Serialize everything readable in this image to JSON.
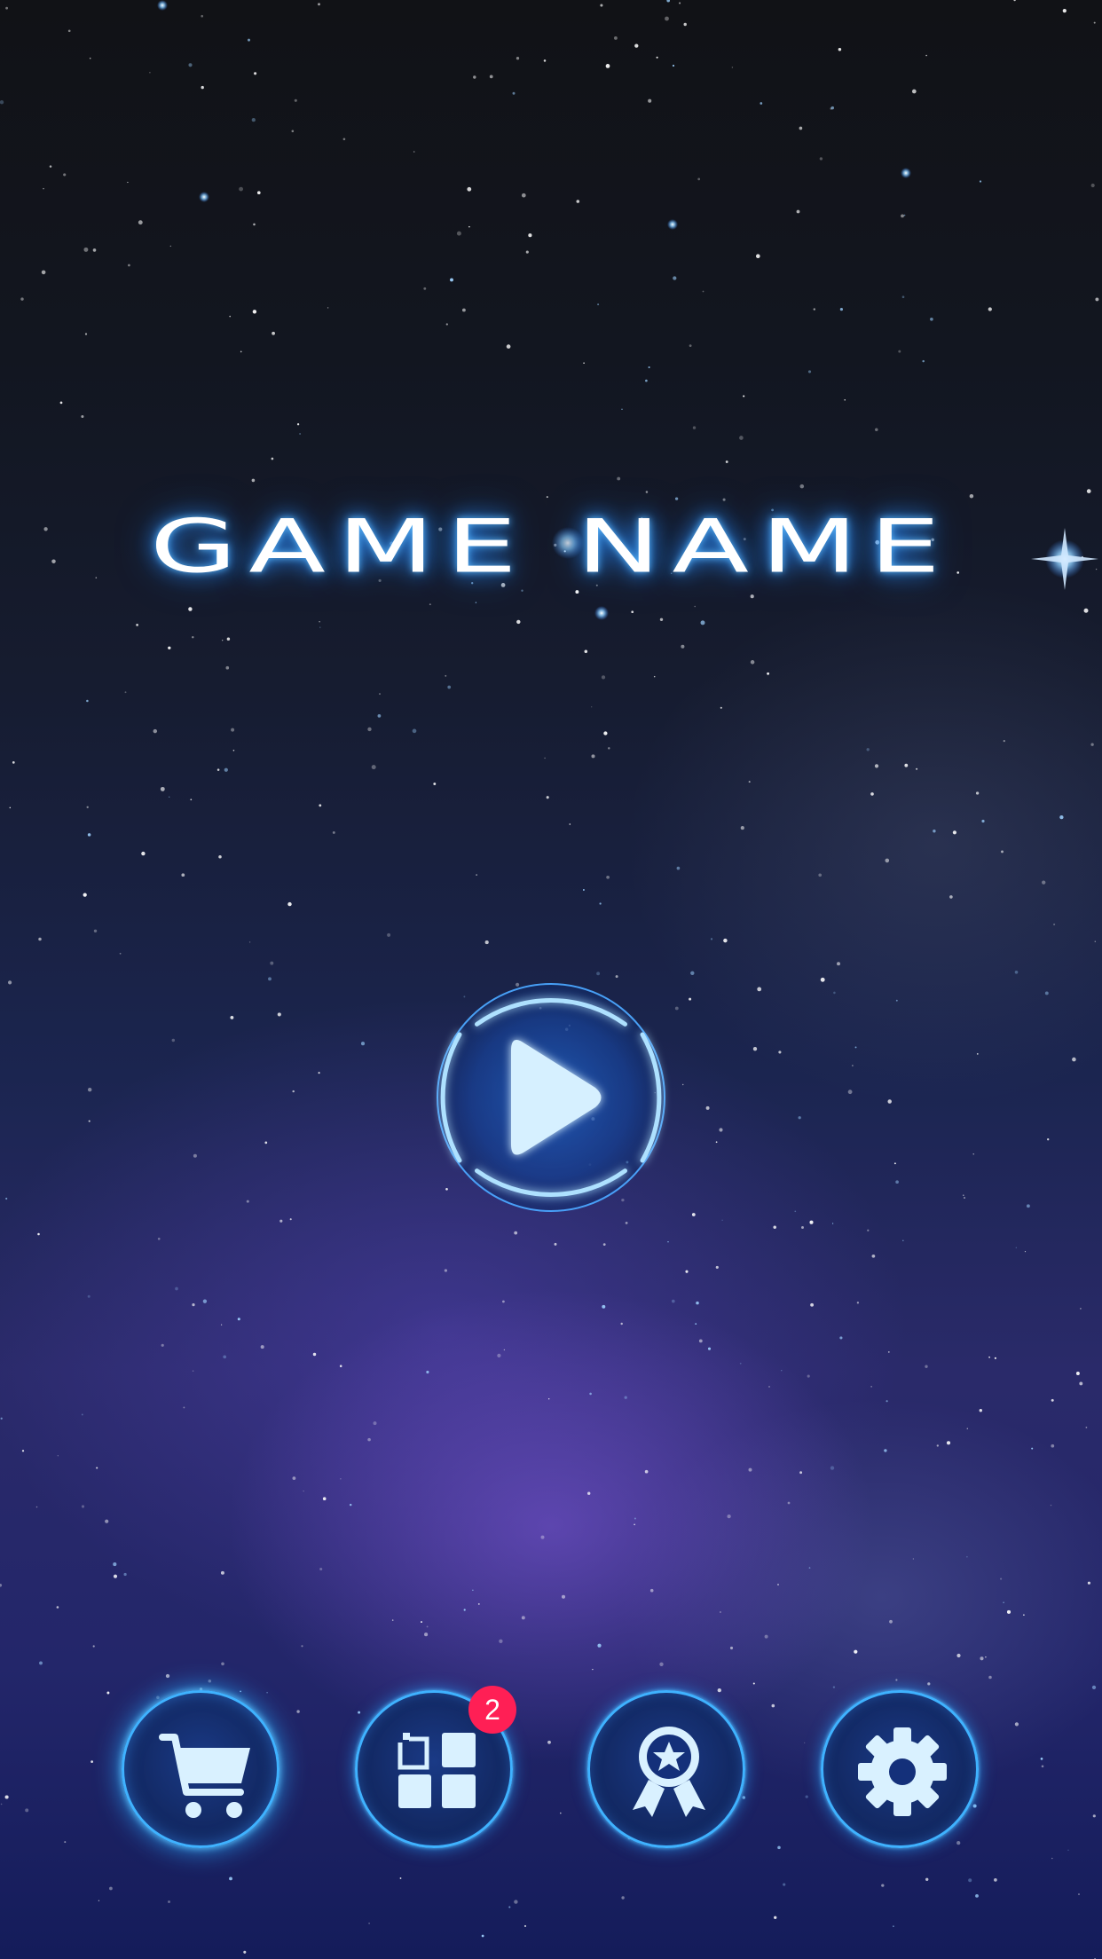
{
  "title": "GAME NAME",
  "play": {
    "icon": "play-icon"
  },
  "nav": [
    {
      "id": "shop",
      "icon": "cart-icon"
    },
    {
      "id": "apps",
      "icon": "grid-icon",
      "badge": "2"
    },
    {
      "id": "achievements",
      "icon": "award-icon"
    },
    {
      "id": "settings",
      "icon": "gear-icon"
    }
  ],
  "colors": {
    "accent": "#3fb2ff",
    "icon": "#d9f1ff",
    "badge": "#ff1f55",
    "title_glow": "#2a8cff"
  }
}
